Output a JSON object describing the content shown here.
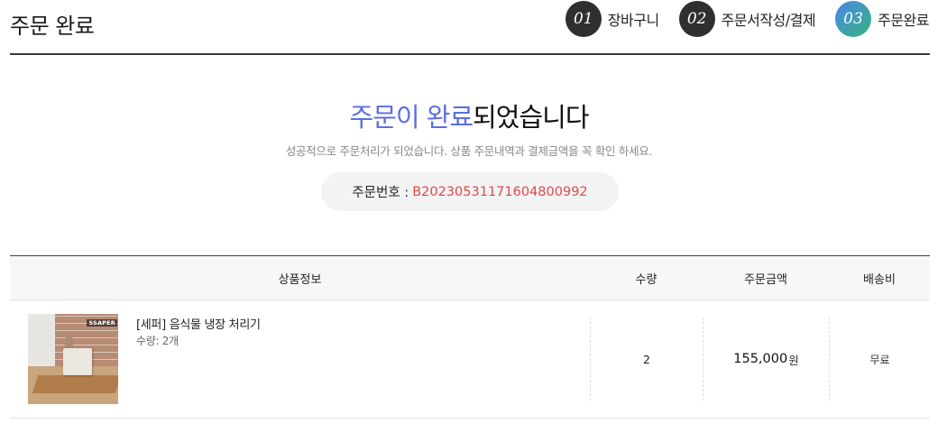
{
  "page_title": "주문 완료",
  "steps": [
    {
      "number": "01",
      "label": "장바구니",
      "active": false
    },
    {
      "number": "02",
      "label": "주문서작성/결제",
      "active": false
    },
    {
      "number": "03",
      "label": "주문완료",
      "active": true
    }
  ],
  "complete": {
    "heading_highlight": "주문이 완료",
    "heading_rest": "되었습니다",
    "description": "성공적으로 주문처리가 되었습니다. 상품 주문내역과 결제금액을 꼭 확인 하세요.",
    "order_number_label": "주문번호 :",
    "order_number": "B20230531171604800992"
  },
  "table": {
    "headers": {
      "product": "상품정보",
      "quantity": "수량",
      "amount": "주문금액",
      "shipping": "배송비"
    },
    "rows": [
      {
        "thumbnail_brand": "SSAPER",
        "product_name": "[세퍼] 음식물 냉장 처리기",
        "quantity_text": "수량: 2개",
        "quantity": "2",
        "price": "155,000",
        "price_unit": "원",
        "shipping": "무료"
      }
    ]
  },
  "colors": {
    "accent_blue": "#5b6ee1",
    "order_number_red": "#e2474b",
    "step_dark": "#2f2f2f"
  }
}
